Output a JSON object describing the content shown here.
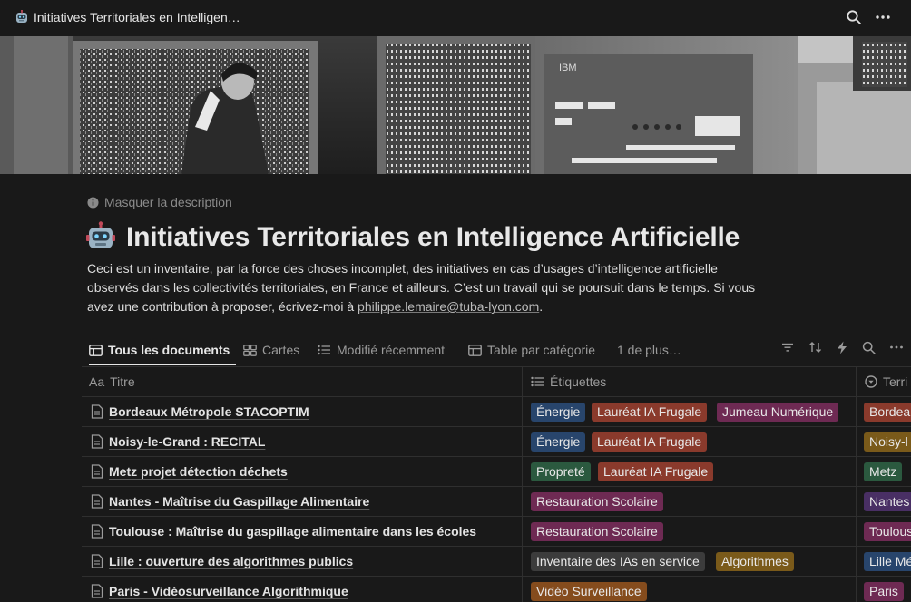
{
  "window": {
    "title": "Initiatives Territoriales en Intelligen…"
  },
  "page": {
    "hide_description": "Masquer la description",
    "title": "Initiatives Territoriales en Intelligence Artificielle",
    "description_line1": "Ceci est un inventaire, par la force des choses incomplet, des initiatives en cas d’usages d’intelligence artificielle",
    "description_line2": "observés dans les collectivités territoriales, en France et ailleurs. C’est un travail qui se poursuit dans le temps. Si vous",
    "description_line3_prefix": "avez une contribution à proposer, écrivez-moi à ",
    "description_email": "philippe.lemaire@tuba-lyon.com",
    "description_line3_suffix": "."
  },
  "views": {
    "tabs": [
      {
        "label": "Tous les documents",
        "icon": "table-icon"
      },
      {
        "label": "Cartes",
        "icon": "gallery-icon"
      },
      {
        "label": "Modifié récemment",
        "icon": "list-icon"
      },
      {
        "label": "Table par catégorie",
        "icon": "table-icon"
      }
    ],
    "more": "1 de plus…"
  },
  "table": {
    "columns": [
      {
        "label": "Titre",
        "prefix": "Aa"
      },
      {
        "label": "Étiquettes",
        "icon": "multi-select-icon"
      },
      {
        "label": "Terri",
        "icon": "select-icon"
      }
    ],
    "rows": [
      {
        "title": "Bordeaux Métropole STACOPTIM",
        "tags": [
          "Énergie",
          "Lauréat IA Frugale",
          "Jumeau Numérique"
        ],
        "territory": "Bordea"
      },
      {
        "title": "Noisy-le-Grand : RECITAL",
        "tags": [
          "Énergie",
          "Lauréat IA Frugale"
        ],
        "territory": "Noisy-l"
      },
      {
        "title": "Metz projet détection déchets",
        "tags": [
          "Propreté",
          "Lauréat IA Frugale"
        ],
        "territory": "Metz"
      },
      {
        "title": "Nantes - Maîtrise du Gaspillage Alimentaire",
        "tags": [
          "Restauration Scolaire"
        ],
        "territory": "Nantes"
      },
      {
        "title": "Toulouse : Maîtrise du gaspillage alimentaire dans les écoles",
        "tags": [
          "Restauration Scolaire"
        ],
        "territory": "Toulous"
      },
      {
        "title": "Lille : ouverture des algorithmes publics",
        "tags": [
          "Inventaire des IAs en service",
          "Algorithmes"
        ],
        "territory": "Lille Mé"
      },
      {
        "title": "Paris - Vidéosurveillance Algorithmique",
        "tags": [
          "Vidéo Surveillance"
        ],
        "territory": "Paris"
      }
    ]
  },
  "colors": {
    "background": "#191919",
    "tag_blue": "#28456c",
    "tag_red": "#8a3a2c",
    "tag_pink": "#6e2a53",
    "tag_green": "#2b593f",
    "tag_gray": "#3c3c3c",
    "tag_brown": "#7a5a1a",
    "tag_orange": "#854c1d",
    "tag_purple": "#492f64"
  }
}
